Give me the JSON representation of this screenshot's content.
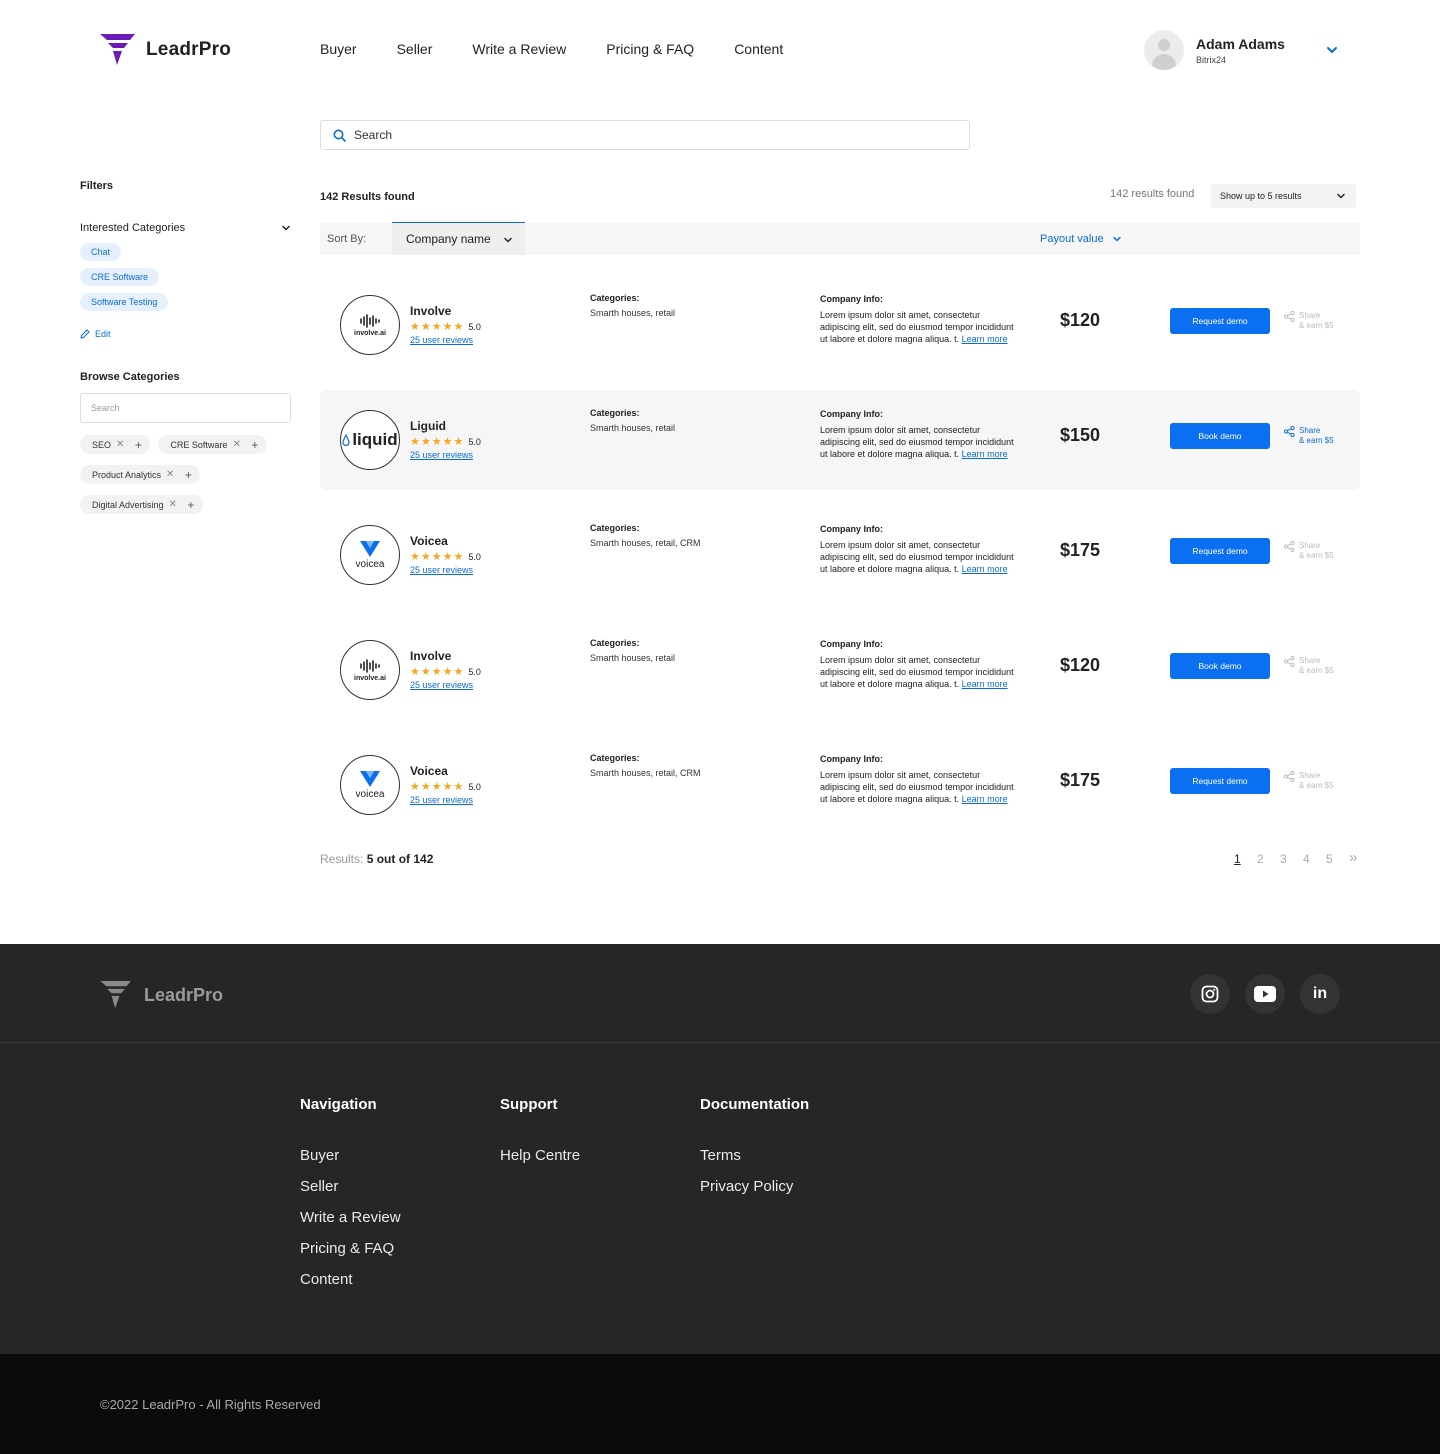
{
  "brand": {
    "name": "LeadrPro",
    "accent": "#0a6ff0",
    "logo_color": "#6a1bb8"
  },
  "nav": [
    "Buyer",
    "Seller",
    "Write a Review",
    "Pricing & FAQ",
    "Content"
  ],
  "user": {
    "name": "Adam Adams",
    "company": "Bitrix24"
  },
  "search": {
    "placeholder": "Search"
  },
  "sidebar": {
    "title": "Filters",
    "interested_title": "Interested Categories",
    "interested": [
      "Chat",
      "CRE Software",
      "Software Testing"
    ],
    "edit_label": "Edit",
    "browse_title": "Browse Categories",
    "browse_placeholder": "Search",
    "browse_tags": [
      "SEO",
      "CRE Software",
      "Product Analytics",
      "Digital Advertising"
    ]
  },
  "results": {
    "count_label": "142 Results found",
    "right_count": "142 results found",
    "show_select": "Show up to 5 results",
    "sort_label": "Sort By:",
    "sort_company": "Company name",
    "sort_payout": "Payout value",
    "foot_label": "Results:",
    "foot_value": "5 out of 142"
  },
  "row_labels": {
    "categories": "Categories:",
    "company_info": "Company Info:",
    "info_text": "Lorem ipsum dolor sit amet, consectetur adipiscing elit, sed do eiusmod tempor incididunt ut labore et dolore magna aliqua. t.",
    "learn_more": "Learn more",
    "share_line1": "Share",
    "share_line2": "& earn $5"
  },
  "companies": [
    {
      "name": "Involve",
      "logo": "involve.ai",
      "rating": "5.0",
      "reviews": "25 user reviews",
      "categories": "Smarth houses, retail",
      "price": "$120",
      "button": "Request demo",
      "highlight": false
    },
    {
      "name": "Liguid",
      "logo": "liquid",
      "rating": "5.0",
      "reviews": "25 user reviews",
      "categories": "Smarth houses, retail",
      "price": "$150",
      "button": "Book demo",
      "highlight": true
    },
    {
      "name": "Voicea",
      "logo": "voicea",
      "rating": "5.0",
      "reviews": "25 user reviews",
      "categories": "Smarth houses, retail, CRM",
      "price": "$175",
      "button": "Request demo",
      "highlight": false
    },
    {
      "name": "Involve",
      "logo": "involve.ai",
      "rating": "5.0",
      "reviews": "25 user reviews",
      "categories": "Smarth houses, retail",
      "price": "$120",
      "button": "Book demo",
      "highlight": false
    },
    {
      "name": "Voicea",
      "logo": "voicea",
      "rating": "5.0",
      "reviews": "25 user reviews",
      "categories": "Smarth houses, retail, CRM",
      "price": "$175",
      "button": "Request demo",
      "highlight": false
    }
  ],
  "pagination": {
    "pages": [
      "1",
      "2",
      "3",
      "4",
      "5"
    ],
    "current": "1",
    "next": "»"
  },
  "footer": {
    "brand": "LeadrPro",
    "socials": [
      "instagram-icon",
      "youtube-icon",
      "linkedin-icon"
    ],
    "columns": [
      {
        "title": "Navigation",
        "links": [
          "Buyer",
          "Seller",
          "Write a Review",
          "Pricing & FAQ",
          "Content"
        ]
      },
      {
        "title": "Support",
        "links": [
          "Help Centre"
        ]
      },
      {
        "title": "Documentation",
        "links": [
          "Terms",
          "Privacy Policy"
        ]
      }
    ],
    "copyright": "©2022 LeadrPro - All Rights Reserved"
  }
}
